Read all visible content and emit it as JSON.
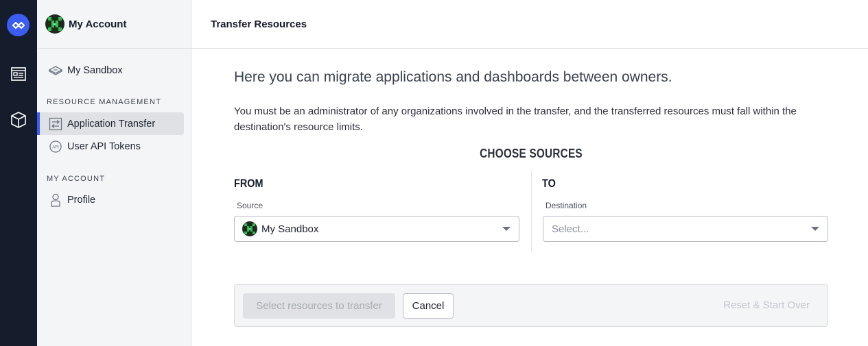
{
  "sidebar": {
    "account_name": "My Account",
    "sandbox_label": "My Sandbox",
    "section_resource": "RESOURCE MANAGEMENT",
    "items_resource": [
      {
        "label": "Application Transfer"
      },
      {
        "label": "User API Tokens"
      }
    ],
    "section_account": "MY ACCOUNT",
    "profile_label": "Profile"
  },
  "header": {
    "title": "Transfer Resources"
  },
  "main": {
    "intro": "Here you can migrate applications and dashboards between owners.",
    "description": "You must be an administrator of any organizations involved in the transfer, and the transferred resources must fall within the destination's resource limits.",
    "choose_heading": "CHOOSE SOURCES",
    "from_heading": "FROM",
    "to_heading": "TO",
    "source_label": "Source",
    "source_value": "My Sandbox",
    "destination_label": "Destination",
    "destination_placeholder": "Select..."
  },
  "actions": {
    "primary": "Select resources to transfer",
    "cancel": "Cancel",
    "reset": "Reset & Start Over"
  },
  "colors": {
    "rail": "#151c2c",
    "accent": "#3b5df2",
    "avatar_green": "#2fbf4f"
  }
}
